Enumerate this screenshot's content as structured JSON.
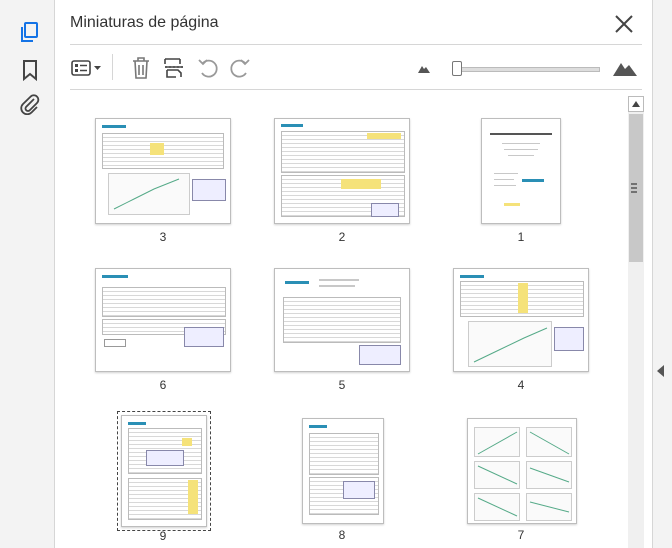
{
  "panel": {
    "title": "Miniaturas de página"
  },
  "thumbnails": [
    {
      "page": "3"
    },
    {
      "page": "2"
    },
    {
      "page": "1"
    },
    {
      "page": "6"
    },
    {
      "page": "5"
    },
    {
      "page": "4"
    },
    {
      "page": "9"
    },
    {
      "page": "8"
    },
    {
      "page": "7"
    }
  ],
  "icons": {
    "page_thumbnails": "page-thumbnails-icon",
    "bookmarks": "bookmark-icon",
    "attachments": "paperclip-icon",
    "options": "options-menu-icon",
    "delete": "trash-icon",
    "insert": "insert-pages-icon",
    "rotate_ccw": "rotate-counterclockwise-icon",
    "rotate_cw": "rotate-clockwise-icon",
    "zoom_out": "small-mountain-icon",
    "zoom_in": "large-mountain-icon"
  },
  "colors": {
    "accent": "#1473e6",
    "selected_border": "#444444"
  },
  "selected_page": "9"
}
